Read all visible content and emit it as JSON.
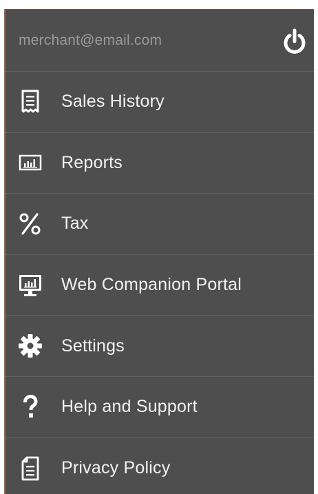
{
  "header": {
    "email": "merchant@email.com",
    "power_icon": "power-icon"
  },
  "menu": {
    "items": [
      {
        "label": "Sales History",
        "icon": "receipt-icon"
      },
      {
        "label": "Reports",
        "icon": "bar-chart-icon"
      },
      {
        "label": "Tax",
        "icon": "percent-icon"
      },
      {
        "label": "Web Companion Portal",
        "icon": "monitor-chart-icon"
      },
      {
        "label": "Settings",
        "icon": "gear-icon"
      },
      {
        "label": "Help and Support",
        "icon": "question-icon"
      },
      {
        "label": "Privacy Policy",
        "icon": "document-icon"
      }
    ]
  },
  "colors": {
    "background": "#4e4e4e",
    "divider": "#626262",
    "text": "#f2f2f2",
    "email_text": "#9a9a9a"
  }
}
